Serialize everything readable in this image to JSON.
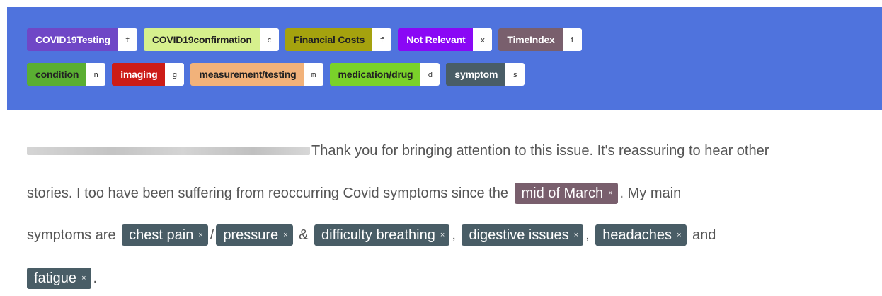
{
  "labels_row1": [
    {
      "name": "COVID19Testing",
      "key": "t",
      "color": "#6f47c6",
      "tone": "dark"
    },
    {
      "name": "COVID19confirmation",
      "key": "c",
      "color": "#d6f08d",
      "tone": "light"
    },
    {
      "name": "Financial Costs",
      "key": "f",
      "color": "#a5a20e",
      "tone": "light"
    },
    {
      "name": "Not Relevant",
      "key": "x",
      "color": "#8a08f5",
      "tone": "dark"
    },
    {
      "name": "TimeIndex",
      "key": "i",
      "color": "#795f6d",
      "tone": "dark"
    }
  ],
  "labels_row2": [
    {
      "name": "condition",
      "key": "n",
      "color": "#5aae32",
      "tone": "light"
    },
    {
      "name": "imaging",
      "key": "g",
      "color": "#cc1c17",
      "tone": "dark"
    },
    {
      "name": "measurement/testing",
      "key": "m",
      "color": "#f2b27a",
      "tone": "light"
    },
    {
      "name": "medication/drug",
      "key": "d",
      "color": "#7ad12a",
      "tone": "light"
    },
    {
      "name": "symptom",
      "key": "s",
      "color": "#495d66",
      "tone": "dark"
    }
  ],
  "annotation_colors": {
    "TimeIndex": "#795f6d",
    "symptom": "#495d66"
  },
  "content": {
    "line1_text": "Thank you for bringing attention to this issue. It's reassuring to hear other",
    "line2_text_a": "stories. I too have been suffering from reoccurring Covid symptoms since the ",
    "line2_ann": "mid of March",
    "line2_text_b": ". My main",
    "line3_text_a": "symptoms are ",
    "line3_ann1": "chest pain",
    "line3_sep1": "/",
    "line3_ann2": "pressure",
    "line3_sep2": " & ",
    "line3_ann3": "difficulty breathing",
    "line3_sep3": ", ",
    "line3_ann4": "digestive issues",
    "line3_sep4": ", ",
    "line3_ann5": "headaches",
    "line3_sep5": " and",
    "line4_ann": "fatigue",
    "line4_text": ".",
    "remove_glyph": "×"
  }
}
